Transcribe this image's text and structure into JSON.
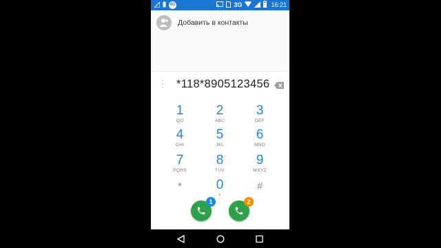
{
  "statusbar": {
    "time": "16:21",
    "network": "3G",
    "badge_text": "4G",
    "battery_level": 0.8
  },
  "contacts": {
    "add_label": "Добавить в контакты"
  },
  "dialer": {
    "number": "*118*8905123456"
  },
  "keypad": {
    "keys": [
      {
        "digit": "1",
        "letters": "QO"
      },
      {
        "digit": "2",
        "letters": "ABC"
      },
      {
        "digit": "3",
        "letters": "DEF"
      },
      {
        "digit": "4",
        "letters": "GHI"
      },
      {
        "digit": "5",
        "letters": "JKL"
      },
      {
        "digit": "6",
        "letters": "MNO"
      },
      {
        "digit": "7",
        "letters": "PQRS"
      },
      {
        "digit": "8",
        "letters": "TUV"
      },
      {
        "digit": "9",
        "letters": "WXYZ"
      },
      {
        "digit": "*",
        "letters": ""
      },
      {
        "digit": "0",
        "letters": "+"
      },
      {
        "digit": "#",
        "letters": ""
      }
    ]
  },
  "call_buttons": [
    {
      "sim": "1",
      "badge_color": "#1e88e5"
    },
    {
      "sim": "2",
      "badge_color": "#fb8c00"
    }
  ],
  "colors": {
    "statusbar": "#1976d2",
    "accent": "#1e88e5",
    "call": "#2ea24a"
  },
  "icons": {
    "status_left": [
      "signal-off-icon",
      "battery-small-icon",
      "app-notification-icon"
    ],
    "status_right": [
      "cast-icon",
      "sim-icon",
      "wifi-icon",
      "cellular-icon",
      "battery-icon"
    ],
    "navbar": [
      "back-icon",
      "home-icon",
      "recents-icon"
    ]
  }
}
